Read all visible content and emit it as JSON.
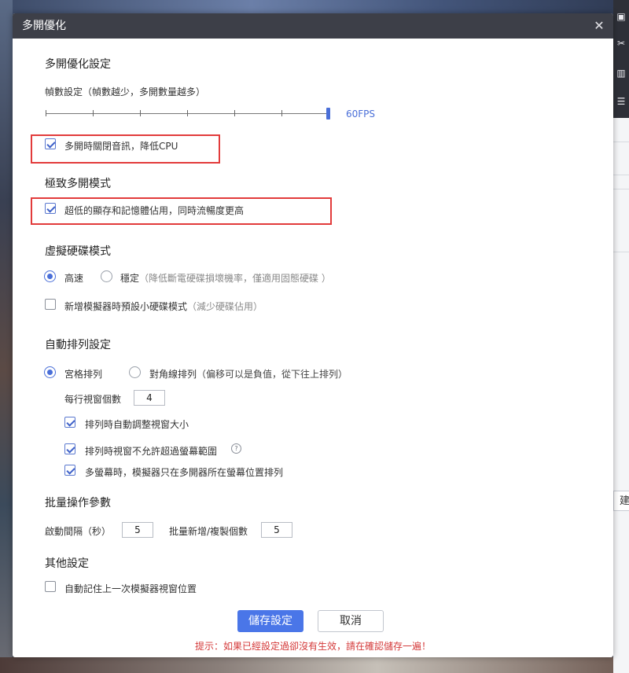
{
  "window": {
    "title": "多開優化",
    "close_icon": "close-icon"
  },
  "background_app": {
    "side_button_label": "建"
  },
  "fps": {
    "section_title": "多開優化設定",
    "label": "幀數設定（幀數越少，多開數量越多）",
    "value_label": "60FPS",
    "value_fraction": 1.0,
    "mute_checkbox": {
      "label": "多開時關閉音訊，降低CPU",
      "checked": true
    }
  },
  "extreme_mode": {
    "section_title": "極致多開模式",
    "checkbox": {
      "label": "超低的顯存和記憶體佔用，同時流暢度更高",
      "checked": true
    }
  },
  "virtual_disk": {
    "section_title": "虛擬硬碟模式",
    "options": [
      {
        "label": "高速",
        "hint": "",
        "selected": true
      },
      {
        "label": "穩定",
        "hint": "（降低斷電硬碟損壞機率，僅適用固態硬碟 ）",
        "selected": false
      }
    ],
    "small_disk": {
      "label": "新增模擬器時預設小硬碟模式",
      "hint": "（減少硬碟佔用）",
      "checked": false
    }
  },
  "auto_arrange": {
    "section_title": "自動排列設定",
    "options": [
      {
        "label": "宮格排列",
        "hint": "",
        "selected": true
      },
      {
        "label": "對角線排列",
        "hint": "（偏移可以是負值，從下往上排列）",
        "selected": false
      }
    ],
    "per_row_label": "每行視窗個數",
    "per_row_value": "4",
    "checks": [
      {
        "label": "排列時自動調整視窗大小",
        "checked": true
      },
      {
        "label": "排列時視窗不允許超過螢幕範圍",
        "checked": true,
        "help_icon": "help-icon"
      },
      {
        "label": "多螢幕時，模擬器只在多開器所在螢幕位置排列",
        "checked": true
      }
    ]
  },
  "batch": {
    "section_title": "批量操作參數",
    "interval_label": "啟動間隔（秒）",
    "interval_value": "5",
    "count_label": "批量新增/複製個數",
    "count_value": "5"
  },
  "other": {
    "section_title": "其他設定",
    "remember_position": {
      "label": "自動記住上一次模擬器視窗位置",
      "checked": false
    }
  },
  "footer": {
    "save_label": "儲存設定",
    "cancel_label": "取消",
    "warning": "提示：如果已經設定過卻沒有生效，請在確認儲存一遍！"
  },
  "colors": {
    "accent": "#4a76e8",
    "highlight_border": "#e23b3b",
    "warning_text": "#d43a3a",
    "titlebar": "#3d3f48"
  }
}
